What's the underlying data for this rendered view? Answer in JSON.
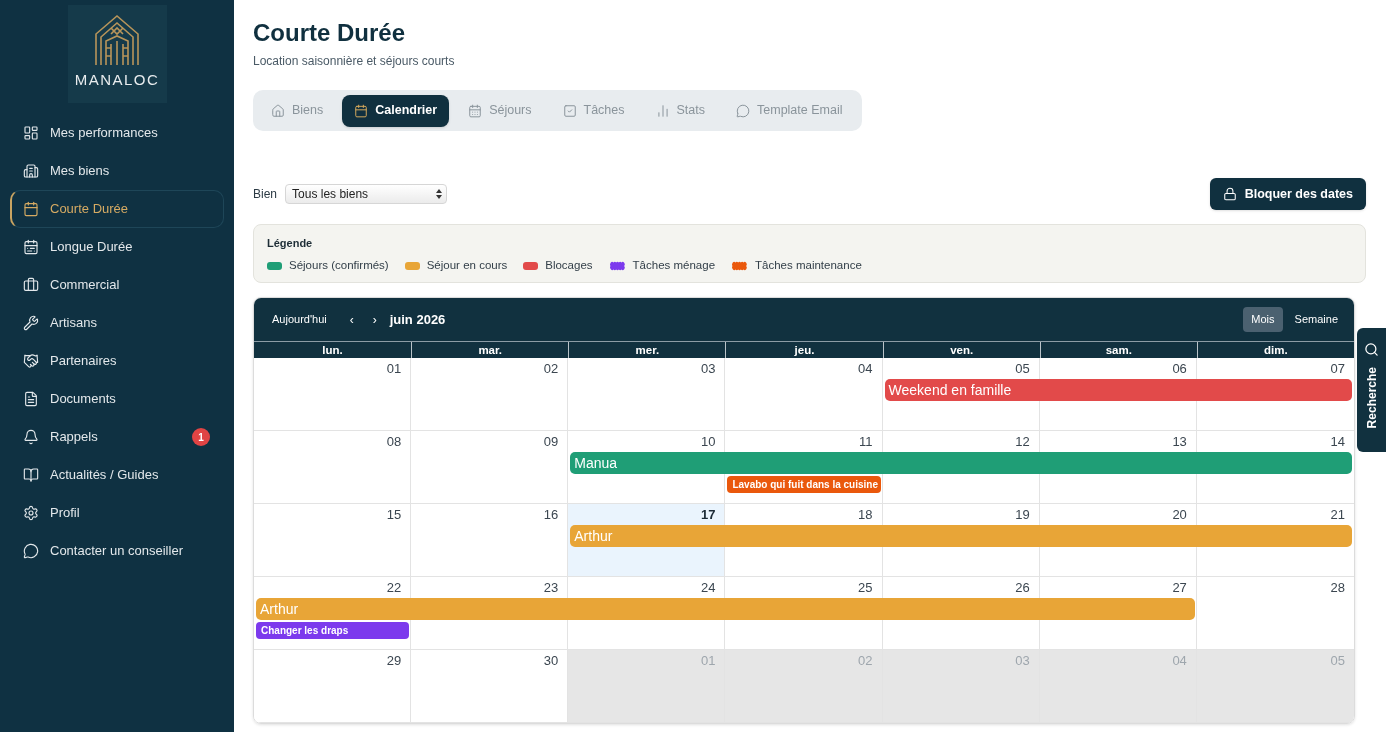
{
  "sidebar": {
    "logo": "MANALOC",
    "items": [
      {
        "label": "Mes performances",
        "selected": false
      },
      {
        "label": "Mes biens",
        "selected": false
      },
      {
        "label": "Courte Durée",
        "selected": true
      },
      {
        "label": "Longue Durée",
        "selected": false
      },
      {
        "label": "Commercial",
        "selected": false
      },
      {
        "label": "Artisans",
        "selected": false
      },
      {
        "label": "Partenaires",
        "selected": false
      },
      {
        "label": "Documents",
        "selected": false
      },
      {
        "label": "Rappels",
        "selected": false,
        "badge": "1"
      },
      {
        "label": "Actualités / Guides",
        "selected": false
      },
      {
        "label": "Profil",
        "selected": false
      },
      {
        "label": "Contacter un conseiller",
        "selected": false
      }
    ]
  },
  "header": {
    "title": "Courte Durée",
    "subtitle": "Location saisonnière et séjours courts"
  },
  "tabs": [
    {
      "label": "Biens",
      "selected": false
    },
    {
      "label": "Calendrier",
      "selected": true
    },
    {
      "label": "Séjours",
      "selected": false
    },
    {
      "label": "Tâches",
      "selected": false
    },
    {
      "label": "Stats",
      "selected": false
    },
    {
      "label": "Template Email",
      "selected": false
    }
  ],
  "filter": {
    "label": "Bien",
    "value": "Tous les biens"
  },
  "block_button": {
    "label": "Bloquer des dates"
  },
  "legend": {
    "title": "Légende",
    "items": [
      {
        "label": "Séjours (confirmés)",
        "kind": "stay",
        "color": "#1f9e76"
      },
      {
        "label": "Séjour en cours",
        "kind": "current_stay",
        "color": "#e8a537"
      },
      {
        "label": "Blocages",
        "kind": "block",
        "color": "#e24a4a"
      },
      {
        "label": "Tâches ménage",
        "kind": "cleaning",
        "color": "#7c3aed"
      },
      {
        "label": "Tâches maintenance",
        "kind": "maintenance",
        "color": "#ea580c"
      }
    ]
  },
  "calendar": {
    "toolbar": {
      "today": "Aujourd'hui",
      "prev": "‹",
      "next": "›",
      "title": "juin 2026",
      "views": [
        {
          "label": "Mois",
          "selected": true
        },
        {
          "label": "Semaine",
          "selected": false
        }
      ]
    },
    "weekdays": [
      "lun.",
      "mar.",
      "mer.",
      "jeu.",
      "ven.",
      "sam.",
      "dim."
    ],
    "weeks": [
      {
        "days": [
          {
            "number": "01",
            "today": false,
            "outside": false
          },
          {
            "number": "02",
            "today": false,
            "outside": false
          },
          {
            "number": "03",
            "today": false,
            "outside": false
          },
          {
            "number": "04",
            "today": false,
            "outside": false
          },
          {
            "number": "05",
            "today": false,
            "outside": false,
            "events": [
              {
                "title": "Weekend en famille",
                "kind": "block"
              }
            ]
          },
          {
            "number": "06",
            "today": false,
            "outside": false,
            "events": [
              {
                "kind": "continued"
              }
            ]
          },
          {
            "number": "07",
            "today": false,
            "outside": false,
            "events": [
              {
                "kind": "continued"
              }
            ]
          }
        ]
      },
      {
        "days": [
          {
            "number": "08",
            "today": false,
            "outside": false
          },
          {
            "number": "09",
            "today": false,
            "outside": false
          },
          {
            "number": "10",
            "today": false,
            "outside": false,
            "events": [
              {
                "title": "Manua",
                "kind": "stay"
              }
            ]
          },
          {
            "number": "11",
            "today": false,
            "outside": false,
            "events": [
              {
                "kind": "continued"
              },
              {
                "title": "Lavabo qui fuit dans la cuisine",
                "kind": "maintenance"
              }
            ]
          },
          {
            "number": "12",
            "today": false,
            "outside": false,
            "events": [
              {
                "kind": "continued"
              }
            ]
          },
          {
            "number": "13",
            "today": false,
            "outside": false,
            "events": [
              {
                "kind": "continued"
              }
            ]
          },
          {
            "number": "14",
            "today": false,
            "outside": false,
            "events": [
              {
                "kind": "continued"
              }
            ]
          }
        ]
      },
      {
        "days": [
          {
            "number": "15",
            "today": false,
            "outside": false
          },
          {
            "number": "16",
            "today": false,
            "outside": false
          },
          {
            "number": "17",
            "today": true,
            "outside": false,
            "events": [
              {
                "title": "Arthur",
                "kind": "current_stay"
              }
            ]
          },
          {
            "number": "18",
            "today": false,
            "outside": false,
            "events": [
              {
                "kind": "continued"
              }
            ]
          },
          {
            "number": "19",
            "today": false,
            "outside": false,
            "events": [
              {
                "kind": "continued"
              }
            ]
          },
          {
            "number": "20",
            "today": false,
            "outside": false,
            "events": [
              {
                "kind": "continued"
              }
            ]
          },
          {
            "number": "21",
            "today": false,
            "outside": false,
            "events": [
              {
                "kind": "continued"
              }
            ]
          }
        ]
      },
      {
        "days": [
          {
            "number": "22",
            "today": false,
            "outside": false,
            "events": [
              {
                "title": "Arthur",
                "kind": "current_stay"
              },
              {
                "title": "Changer les draps",
                "kind": "cleaning"
              }
            ]
          },
          {
            "number": "23",
            "today": false,
            "outside": false,
            "events": [
              {
                "kind": "continued"
              }
            ]
          },
          {
            "number": "24",
            "today": false,
            "outside": false,
            "events": [
              {
                "kind": "continued"
              }
            ]
          },
          {
            "number": "25",
            "today": false,
            "outside": false,
            "events": [
              {
                "kind": "continued"
              }
            ]
          },
          {
            "number": "26",
            "today": false,
            "outside": false,
            "events": [
              {
                "kind": "continued"
              }
            ]
          },
          {
            "number": "27",
            "today": false,
            "outside": false,
            "events": [
              {
                "kind": "continued"
              }
            ]
          },
          {
            "number": "28",
            "today": false,
            "outside": false
          }
        ]
      },
      {
        "days": [
          {
            "number": "29",
            "today": false,
            "outside": false
          },
          {
            "number": "30",
            "today": false,
            "outside": false
          },
          {
            "number": "01",
            "today": false,
            "outside": true
          },
          {
            "number": "02",
            "today": false,
            "outside": true
          },
          {
            "number": "03",
            "today": false,
            "outside": true
          },
          {
            "number": "04",
            "today": false,
            "outside": true
          },
          {
            "number": "05",
            "today": false,
            "outside": true
          }
        ]
      }
    ]
  },
  "search_tab": {
    "label": "Recherche"
  }
}
